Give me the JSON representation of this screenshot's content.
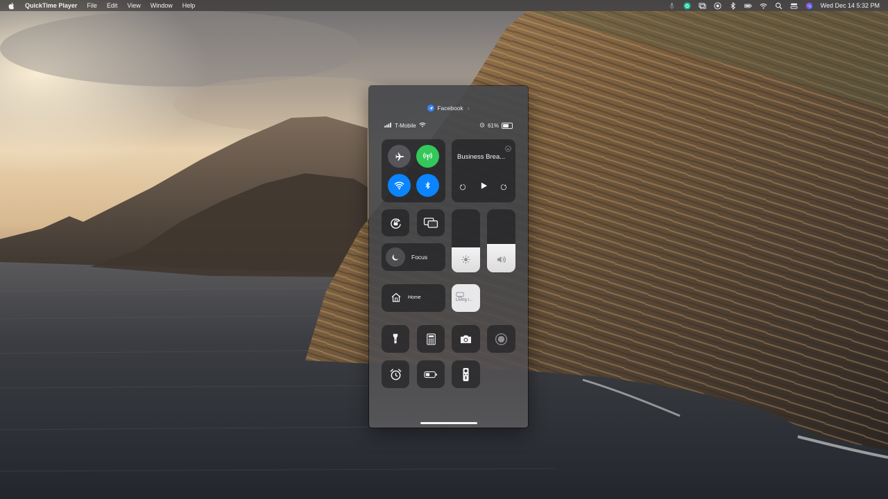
{
  "menubar": {
    "app_name": "QuickTime Player",
    "items": [
      "File",
      "Edit",
      "View",
      "Window",
      "Help"
    ],
    "clock": "Wed Dec 14  5:32 PM",
    "status_icons": [
      "mic-icon",
      "grammarly-icon",
      "screen-mirror-icon",
      "record-icon",
      "bluetooth-icon",
      "battery-icon",
      "wifi-icon",
      "search-icon",
      "control-center-icon",
      "siri-icon"
    ]
  },
  "phone": {
    "top_app": "Facebook",
    "status": {
      "carrier": "T-Mobile",
      "battery": "61%"
    },
    "connectivity": {
      "airplane_icon": "airplane-icon",
      "cellular_icon": "cellular-icon",
      "wifi_icon": "wifi-icon",
      "bluetooth_icon": "bluetooth-icon"
    },
    "now_playing": {
      "title": "Business Brea..."
    },
    "focus_label": "Focus",
    "home_label": "Home",
    "living_room_label": "Living r...",
    "brightness_level": 0.4,
    "volume_level": 0.45
  },
  "colors": {
    "green": "#34c759",
    "blue": "#0a84ff"
  }
}
